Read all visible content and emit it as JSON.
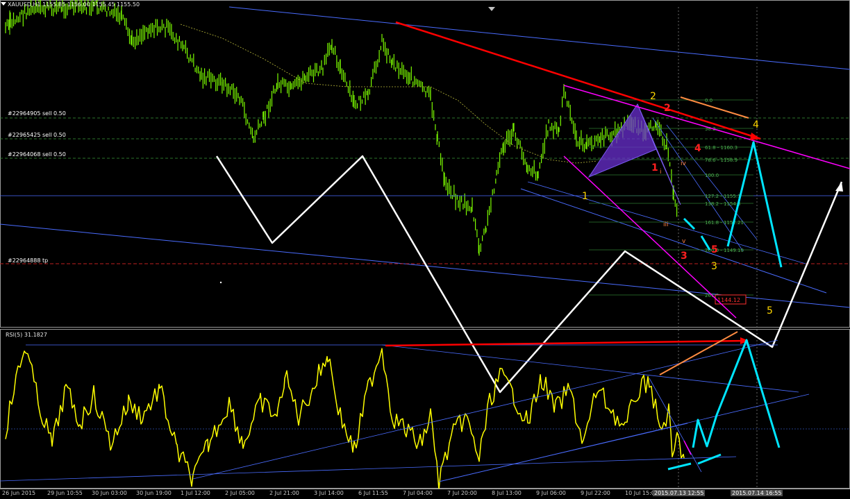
{
  "header": {
    "symbol_title": "XAUUSD,H1",
    "ohlc": "1155.85 1156.00 1155.45 1155.50"
  },
  "orders": [
    {
      "label": "#22964905 sell 0.50"
    },
    {
      "label": "#22965425 sell 0.50"
    },
    {
      "label": "#22964068 sell 0.50"
    },
    {
      "label": "#22964888 tp"
    }
  ],
  "fib_levels": [
    "0.0",
    "38.2",
    "61.8 - 1160.3",
    "78.6 - 1158.9",
    "100.0",
    "127.2 - 1155.1",
    "138.2 - 1154.3",
    "161.8 - 1152.21",
    "200.0 - 1149.10",
    "261.8"
  ],
  "price_box": "1144.12",
  "wave_labels": {
    "yellow": [
      "1",
      "2",
      "3",
      "4",
      "5"
    ],
    "red": [
      "1",
      "2",
      "3",
      "4",
      "5"
    ],
    "roman": [
      "i",
      "iii",
      "iv",
      "v"
    ]
  },
  "rsi": {
    "label": "RSI(5) 31.1827"
  },
  "chart_data": {
    "type": "line",
    "symbol": "XAUUSD",
    "timeframe": "H1",
    "x_ticks": [
      "26 Jun 2015",
      "29 Jun 10:55",
      "30 Jun 03:00",
      "30 Jun 19:00",
      "1 Jul 12:00",
      "2 Jul 05:00",
      "2 Jul 21:00",
      "3 Jul 14:00",
      "6 Jul 11:55",
      "7 Jul 04:00",
      "7 Jul 20:00",
      "8 Jul 13:00",
      "9 Jul 06:00",
      "9 Jul 22:00",
      "10 Jul 15:00",
      "2015.07.13 12:55",
      "2015.07.14 16:55"
    ],
    "highlighted_ticks": [
      "2015.07.13 12:55",
      "2015.07.14 16:55"
    ],
    "series": [
      {
        "name": "RSI(5)",
        "last_value": 31.1827
      }
    ],
    "grid": false
  },
  "colors": {
    "background": "#000000",
    "candle": "#7CFC00",
    "rsi_line": "#ffff00",
    "trend_red": "#ff0000",
    "channel_magenta": "#ff00ff",
    "projection_white": "#ffffff",
    "projection_cyan": "#00e5ff",
    "trend_blue": "#4a6cff",
    "fib_green": "#2e7d32",
    "orange": "#ff8c42",
    "harmonic_fill": "#6a2fd0"
  }
}
